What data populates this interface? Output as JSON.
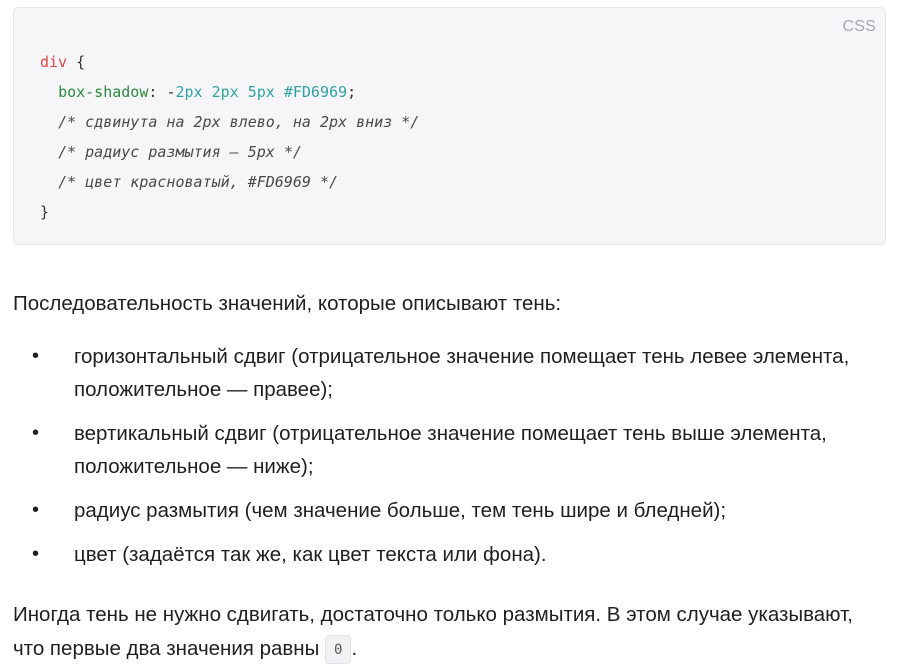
{
  "code_block": {
    "language_label": "CSS",
    "selector": "div",
    "open_brace": " {",
    "property": "box-shadow",
    "colon": ": ",
    "minus": "-",
    "value_1": "2px",
    "value_2": "2px",
    "value_3": "5px",
    "value_4": "#FD6969",
    "semicolon": ";",
    "comment_1": "/* сдвинута на 2px влево, на 2px вниз */",
    "comment_2": "/* радиус размытия — 5px */",
    "comment_3": "/* цвет красноватый, #FD6969 */",
    "close_brace": "}"
  },
  "intro_text": "Последовательность значений, которые описывают тень:",
  "list_items": [
    "горизонтальный сдвиг (отрицательное значение помещает тень левее элемента, положительное — правее);",
    "вертикальный сдвиг (отрицательное значение помещает тень выше элемента, положительное — ниже);",
    "радиус размытия (чем значение больше, тем тень шире и бледней);",
    "цвет (задаётся так же, как цвет текста или фона)."
  ],
  "bullet_char": "•",
  "closing_paragraph": {
    "text_before": "Иногда тень не нужно сдвигать, достаточно только размытия. В этом случае указывают, что первые два значения равны ",
    "inline_code": "0",
    "text_after": "."
  }
}
